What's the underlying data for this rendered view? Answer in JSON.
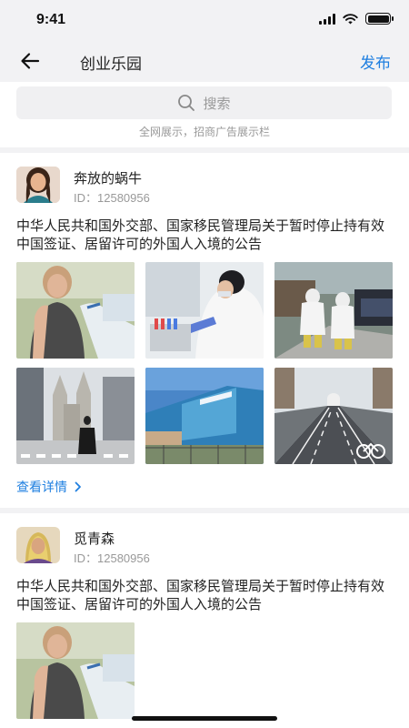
{
  "status_bar": {
    "time": "9:41"
  },
  "nav": {
    "title": "创业乐园",
    "publish_label": "发布"
  },
  "search": {
    "placeholder": "搜索",
    "hint": "全网展示，招商广告展示栏"
  },
  "posts": [
    {
      "author": "奔放的蜗牛",
      "id_text": "ID：12580956",
      "text": "中华人民共和国外交部、国家移民管理局关于暂时停止持有效中国签证、居留许可的外国人入境的公告",
      "photos": [
        "woman-receiving-vaccine",
        "lab-worker-with-test-tubes",
        "workers-in-protective-suits",
        "cathedral-street-with-pedestrian",
        "building-with-blue-sign",
        "empty-avenue-with-bike-lane"
      ],
      "details_label": "查看详情"
    },
    {
      "author": "觅青森",
      "id_text": "ID：12580956",
      "text": "中华人民共和国外交部、国家移民管理局关于暂时停止持有效中国签证、居留许可的外国人入境的公告",
      "photos": [
        "woman-receiving-vaccine"
      ]
    }
  ]
}
